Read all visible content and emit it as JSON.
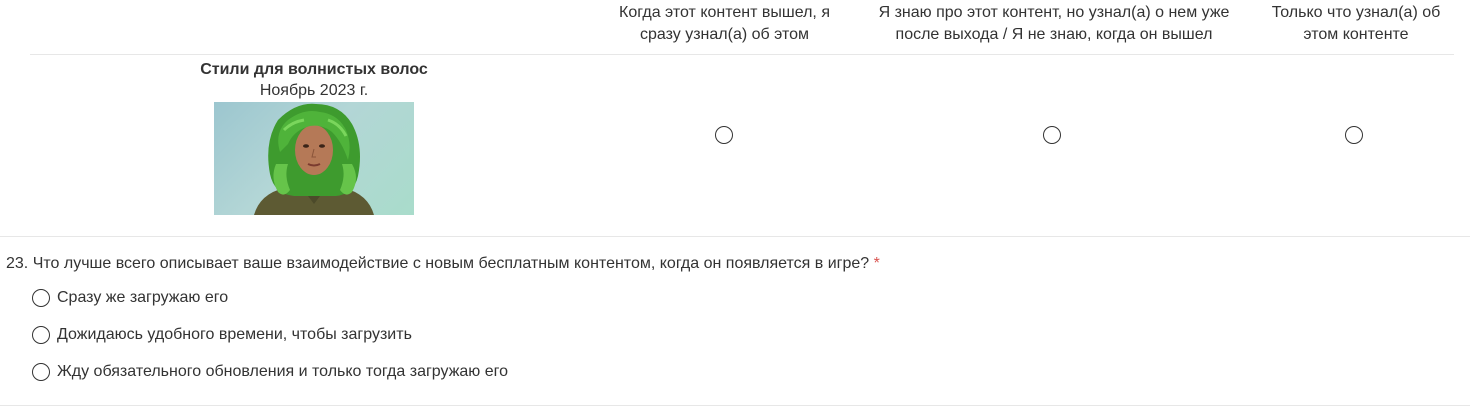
{
  "matrix": {
    "columns": [
      {
        "line1": "Когда этот контент вышел, я",
        "line2": "сразу узнал(а) об этом"
      },
      {
        "line1": "Я знаю про этот контент, но узнал(а) о нем уже",
        "line2": "после выхода / Я не знаю, когда он вышел"
      },
      {
        "line1": "Только что узнал(а) об",
        "line2": "этом контенте"
      }
    ],
    "row": {
      "title": "Стили для волнистых волос",
      "date": "Ноябрь 2023 г.",
      "image": "sim-character-green-wavy-hair"
    }
  },
  "question": {
    "number": "23.",
    "text": "Что лучше всего описывает ваше взаимодействие с новым бесплатным контентом, когда он появляется в игре?",
    "required_mark": "*",
    "options": [
      "Сразу же загружаю его",
      "Дожидаюсь удобного времени, чтобы загрузить",
      "Жду обязательного обновления и только тогда загружаю его"
    ]
  },
  "colors": {
    "required": "#d9534f",
    "text": "#333333",
    "divider": "#e7e7e7"
  }
}
